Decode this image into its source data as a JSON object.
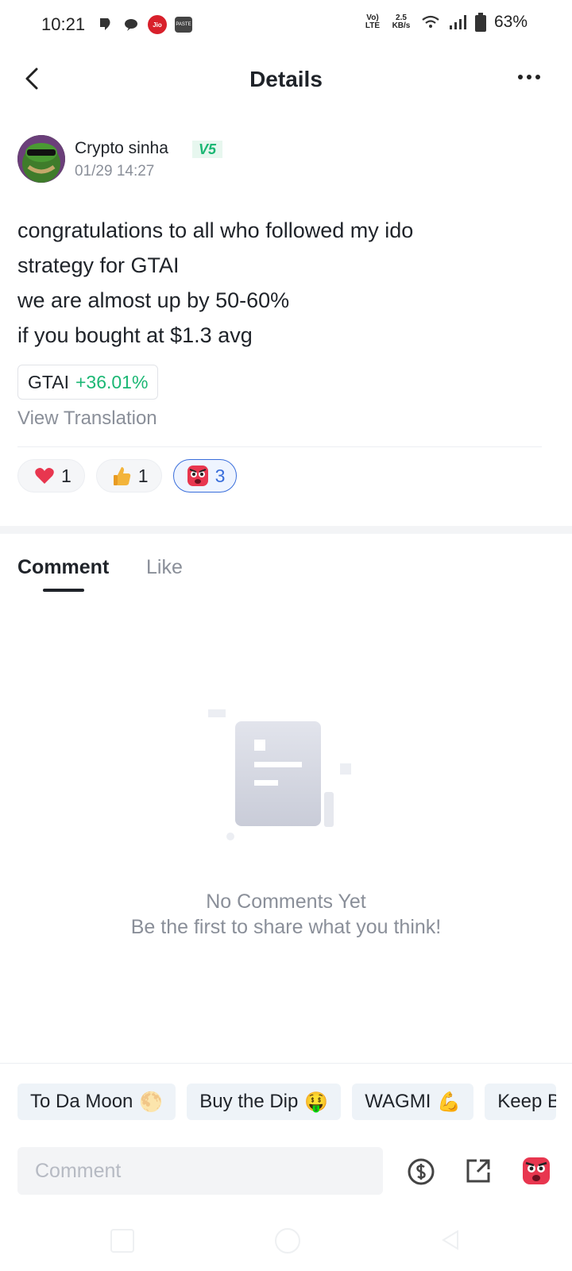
{
  "status_bar": {
    "time": "10:21",
    "network_label": "Vo) LTE",
    "speed_value": "2.5",
    "speed_unit": "KB/s",
    "battery": "63%",
    "jio_label": "Jio",
    "app_label": "PASTE"
  },
  "header": {
    "title": "Details"
  },
  "post": {
    "author": "Crypto sinha",
    "level_badge": "V5",
    "timestamp": "01/29 14:27",
    "lines": [
      "congratulations to all who followed my ido",
      "strategy for GTAI",
      "we are almost up by 50-60%",
      "if you bought at $1.3 avg"
    ],
    "ticker": {
      "symbol": "GTAI",
      "change": "+36.01%"
    },
    "translate_label": "View Translation",
    "reactions": [
      {
        "icon": "heart-icon",
        "count": "1"
      },
      {
        "icon": "thumbs-up-icon",
        "count": "1"
      },
      {
        "icon": "angry-face-icon",
        "count": "3"
      }
    ]
  },
  "tabs": [
    {
      "label": "Comment",
      "active": true
    },
    {
      "label": "Like",
      "active": false
    }
  ],
  "empty_state": {
    "title": "No Comments Yet",
    "subtitle": "Be the first to share what you think!"
  },
  "quick_replies": [
    {
      "label": "To Da Moon",
      "emoji": "🌕"
    },
    {
      "label": "Buy the Dip",
      "emoji": "🤑"
    },
    {
      "label": "WAGMI",
      "emoji": "💪"
    },
    {
      "label": "Keep B",
      "emoji": ""
    }
  ],
  "comment_bar": {
    "placeholder": "Comment"
  },
  "colors": {
    "accent_green": "#1bb774",
    "active_blue": "#3a6edb",
    "text_primary": "#1f2329",
    "text_secondary": "#8a8f99"
  }
}
